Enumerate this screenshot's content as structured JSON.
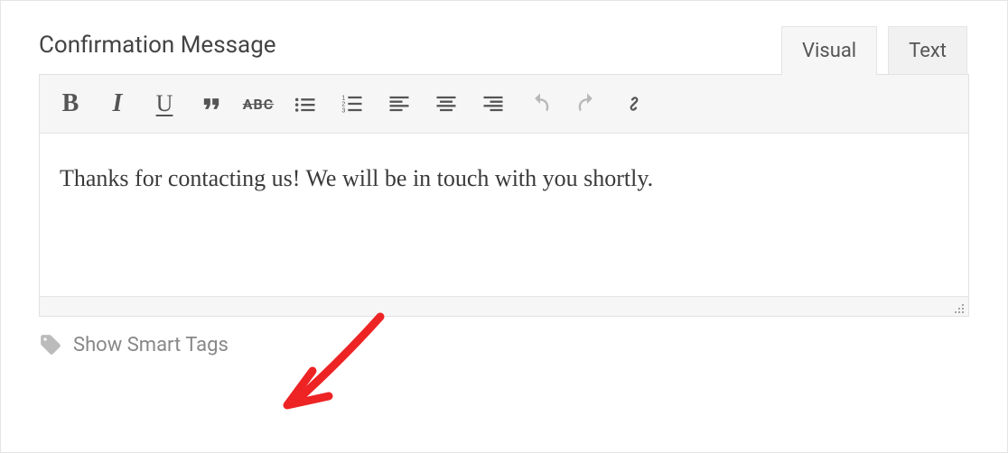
{
  "section": {
    "title": "Confirmation Message"
  },
  "tabs": {
    "visual": "Visual",
    "text": "Text"
  },
  "toolbar": {
    "bold_glyph": "B",
    "italic_glyph": "I",
    "underline_glyph": "U",
    "strike_glyph": "ABC"
  },
  "editor": {
    "content": "Thanks for contacting us! We will be in touch with you shortly."
  },
  "smart_tags": {
    "label": "Show Smart Tags"
  }
}
